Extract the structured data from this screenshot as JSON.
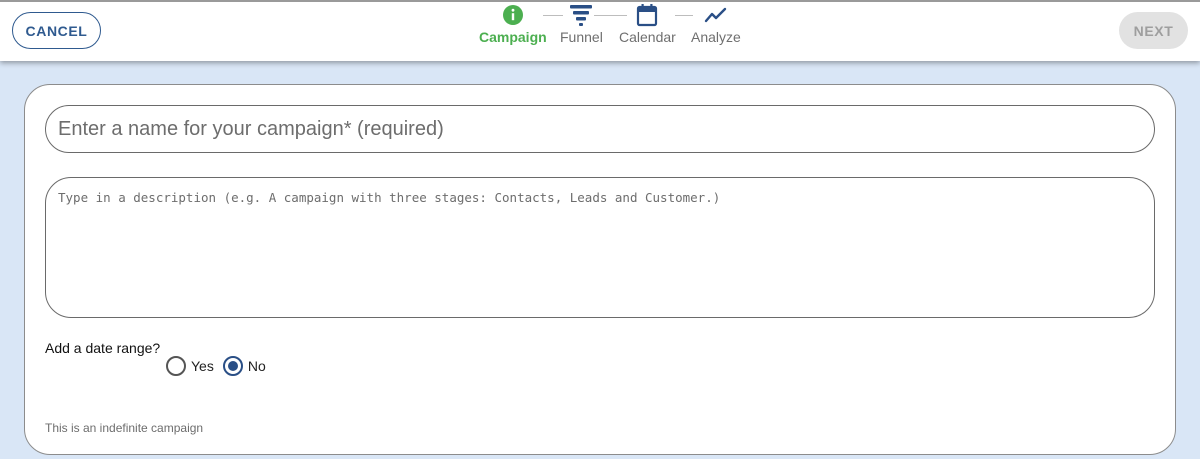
{
  "header": {
    "cancel_label": "CANCEL",
    "next_label": "NEXT",
    "steps": [
      {
        "label": "Campaign",
        "icon": "info-icon",
        "active": true
      },
      {
        "label": "Funnel",
        "icon": "funnel-icon",
        "active": false
      },
      {
        "label": "Calendar",
        "icon": "calendar-icon",
        "active": false
      },
      {
        "label": "Analyze",
        "icon": "trend-line-icon",
        "active": false
      }
    ]
  },
  "form": {
    "name_placeholder": "Enter a name for your campaign* (required)",
    "name_value": "",
    "description_placeholder": "Type in a description (e.g. A campaign with three stages: Contacts, Leads and Customer.)",
    "description_value": "",
    "date_range_question": "Add a date range?",
    "options": [
      {
        "label": "Yes",
        "selected": false
      },
      {
        "label": "No",
        "selected": true
      }
    ],
    "hint": "This is an indefinite campaign"
  },
  "colors": {
    "accent_green": "#4caf50",
    "primary_blue": "#2a4f86",
    "page_background": "#d9e6f6"
  }
}
